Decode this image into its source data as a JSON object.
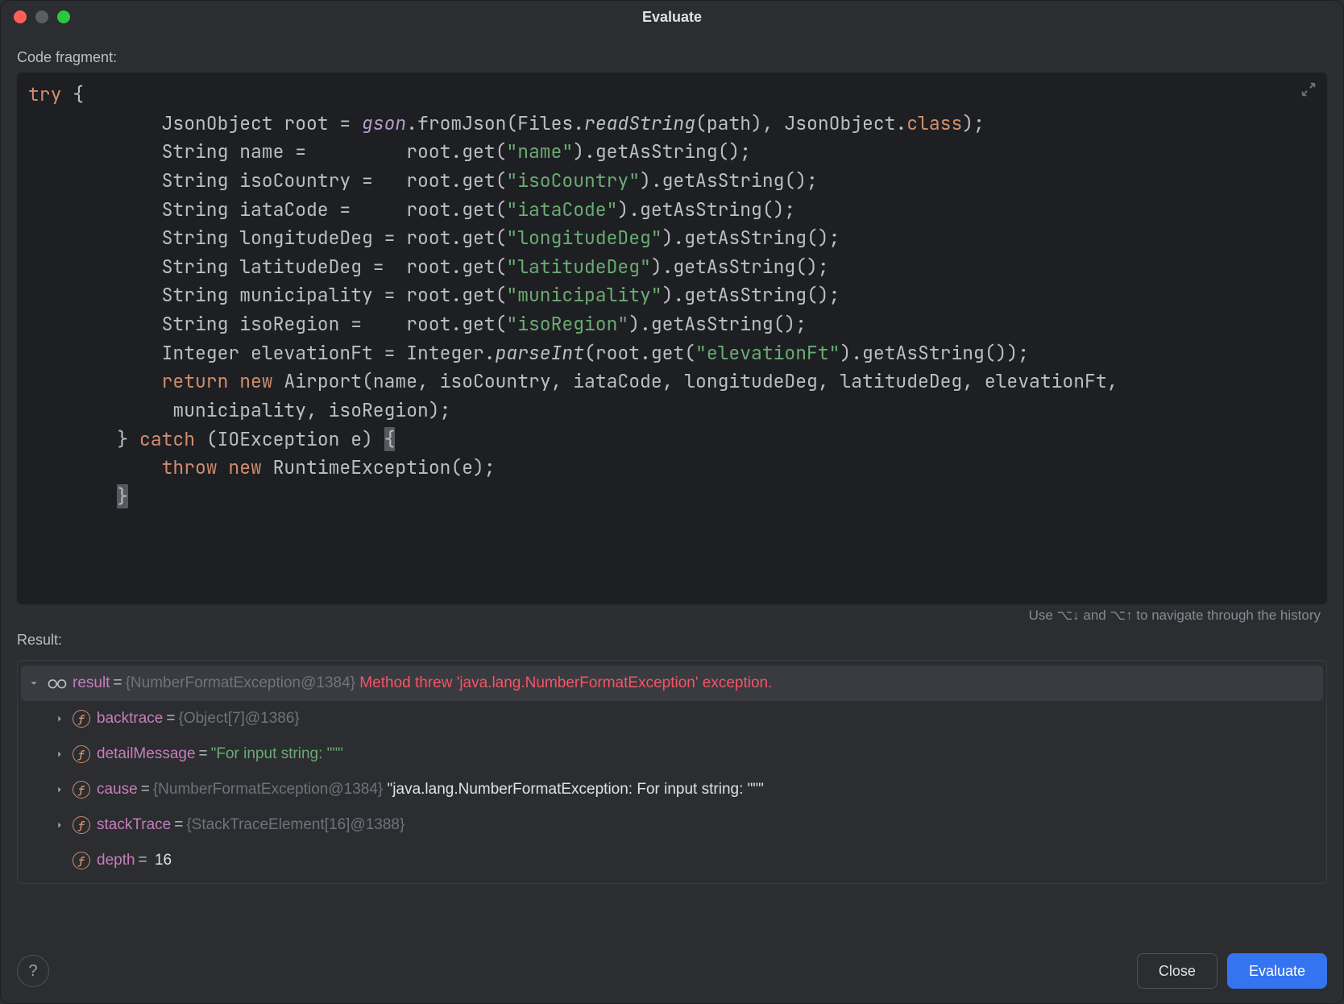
{
  "window": {
    "title": "Evaluate"
  },
  "labels": {
    "code_fragment": "Code fragment:",
    "result": "Result:",
    "hint": "Use ⌥↓ and ⌥↑ to navigate through the history"
  },
  "code": {
    "tokens": [
      [
        {
          "t": "try",
          "c": "kw"
        },
        {
          "t": " {",
          "c": "id"
        }
      ],
      [
        {
          "t": "            JsonObject root = ",
          "c": "id"
        },
        {
          "t": "gson",
          "c": "fn-italic"
        },
        {
          "t": ".fromJson(Files.",
          "c": "id"
        },
        {
          "t": "readString",
          "c": "fn-static"
        },
        {
          "t": "(path), JsonObject.",
          "c": "id"
        },
        {
          "t": "class",
          "c": "kw"
        },
        {
          "t": ");",
          "c": "id"
        }
      ],
      [
        {
          "t": "            String name =         root.get(",
          "c": "id"
        },
        {
          "t": "\"name\"",
          "c": "str"
        },
        {
          "t": ").getAsString();",
          "c": "id"
        }
      ],
      [
        {
          "t": "            String isoCountry =   root.get(",
          "c": "id"
        },
        {
          "t": "\"isoCountry\"",
          "c": "str"
        },
        {
          "t": ").getAsString();",
          "c": "id"
        }
      ],
      [
        {
          "t": "            String iataCode =     root.get(",
          "c": "id"
        },
        {
          "t": "\"iataCode\"",
          "c": "str"
        },
        {
          "t": ").getAsString();",
          "c": "id"
        }
      ],
      [
        {
          "t": "            String longitudeDeg = root.get(",
          "c": "id"
        },
        {
          "t": "\"longitudeDeg\"",
          "c": "str"
        },
        {
          "t": ").getAsString();",
          "c": "id"
        }
      ],
      [
        {
          "t": "            String latitudeDeg =  root.get(",
          "c": "id"
        },
        {
          "t": "\"latitudeDeg\"",
          "c": "str"
        },
        {
          "t": ").getAsString();",
          "c": "id"
        }
      ],
      [
        {
          "t": "            String municipality = root.get(",
          "c": "id"
        },
        {
          "t": "\"municipality\"",
          "c": "str"
        },
        {
          "t": ").getAsString();",
          "c": "id"
        }
      ],
      [
        {
          "t": "            String isoRegion =    root.get(",
          "c": "id"
        },
        {
          "t": "\"isoRegion\"",
          "c": "str"
        },
        {
          "t": ").getAsString();",
          "c": "id"
        }
      ],
      [
        {
          "t": "            Integer elevationFt = Integer.",
          "c": "id"
        },
        {
          "t": "parseInt",
          "c": "fn-static"
        },
        {
          "t": "(root.get(",
          "c": "id"
        },
        {
          "t": "\"elevationFt\"",
          "c": "str"
        },
        {
          "t": ").getAsString());",
          "c": "id"
        }
      ],
      [
        {
          "t": "            ",
          "c": "id"
        },
        {
          "t": "return new",
          "c": "kw"
        },
        {
          "t": " Airport(name, isoCountry, iataCode, longitudeDeg, latitudeDeg, elevationFt,",
          "c": "id"
        }
      ],
      [
        {
          "t": "             municipality, isoRegion);",
          "c": "id"
        }
      ],
      [
        {
          "t": "        } ",
          "c": "id"
        },
        {
          "t": "catch",
          "c": "kw"
        },
        {
          "t": " (IOException e) ",
          "c": "id"
        },
        {
          "t": "{",
          "c": "cursor-caret"
        }
      ],
      [
        {
          "t": "            ",
          "c": "id"
        },
        {
          "t": "throw new",
          "c": "kw"
        },
        {
          "t": " RuntimeException(e);",
          "c": "id"
        }
      ],
      [
        {
          "t": "        ",
          "c": "id"
        },
        {
          "t": "}",
          "c": "cursor-caret"
        }
      ]
    ]
  },
  "result_tree": {
    "root": {
      "name": "result",
      "type_text": "{NumberFormatException@1384}",
      "message": "Method threw 'java.lang.NumberFormatException' exception."
    },
    "children": [
      {
        "name": "backtrace",
        "gray": "{Object[7]@1386}",
        "has_chevron": true
      },
      {
        "name": "detailMessage",
        "green": "\"For input string: \"\"\"",
        "has_chevron": true
      },
      {
        "name": "cause",
        "gray": "{NumberFormatException@1384}",
        "white": "\"java.lang.NumberFormatException: For input string: \"\"\"",
        "has_chevron": true,
        "badge": "f↺"
      },
      {
        "name": "stackTrace",
        "gray": "{StackTraceElement[16]@1388}",
        "has_chevron": true
      },
      {
        "name": "depth",
        "white": "16",
        "has_chevron": false
      }
    ]
  },
  "footer": {
    "close": "Close",
    "evaluate": "Evaluate"
  }
}
